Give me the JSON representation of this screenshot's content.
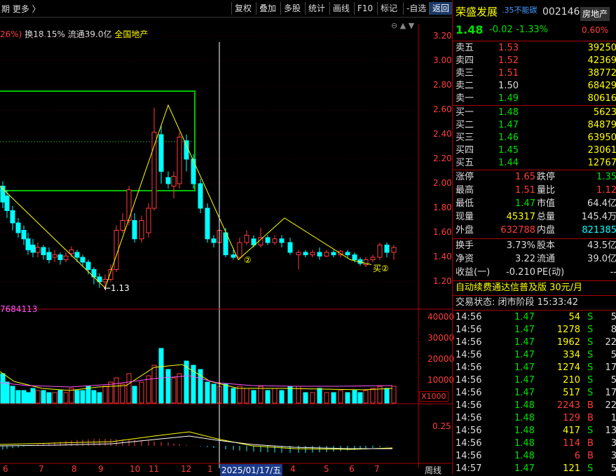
{
  "toolbar": {
    "left_label": "期 更多 〉",
    "buttons": [
      "复权",
      "叠加",
      "多股",
      "统计",
      "画线",
      "F10",
      "标记",
      "-自选",
      "返回"
    ]
  },
  "info": {
    "pct": "26%)",
    "turnover": "换18.15%",
    "float": "流通39.0亿",
    "sector": "全国地产"
  },
  "price_axis": [
    "3.20",
    "3.00",
    "2.80",
    "2.60",
    "2.40",
    "2.20",
    "2.00",
    "1.80",
    "1.60",
    "1.40",
    "1.20"
  ],
  "annotations": {
    "low": "←1.13",
    "mark1": "②",
    "mark2": "买②"
  },
  "volume": {
    "label": "7684113",
    "axis": [
      "40000",
      "30000",
      "20000",
      "10000"
    ],
    "unit": "X1000"
  },
  "macd": {
    "axis_label": "0.25"
  },
  "date_axis": {
    "labels": [
      "6",
      "7",
      "8",
      "9",
      "10",
      "11",
      "12",
      "1",
      "2025/01/17/五",
      "4",
      "5",
      "6",
      "7"
    ],
    "period": "周线"
  },
  "quote": {
    "name": "荣盛发展",
    "note": ".35不能碳",
    "code": "002146",
    "sector_badge": "房地产",
    "price": "1.48",
    "change": "-0.02",
    "change_pct": "-1.33%",
    "sector_pct": "0.60%",
    "asks": [
      {
        "label": "卖五",
        "price": "1.53",
        "vol": "39250"
      },
      {
        "label": "卖四",
        "price": "1.52",
        "vol": "42369"
      },
      {
        "label": "卖三",
        "price": "1.51",
        "vol": "38772"
      },
      {
        "label": "卖二",
        "price": "1.50",
        "vol": "68429"
      },
      {
        "label": "卖一",
        "price": "1.49",
        "vol": "80616"
      }
    ],
    "bids": [
      {
        "label": "买一",
        "price": "1.48",
        "vol": "5623"
      },
      {
        "label": "买二",
        "price": "1.47",
        "vol": "84879"
      },
      {
        "label": "买三",
        "price": "1.46",
        "vol": "63950"
      },
      {
        "label": "买四",
        "price": "1.45",
        "vol": "23061"
      },
      {
        "label": "买五",
        "price": "1.44",
        "vol": "12767"
      }
    ],
    "stats": [
      {
        "l1": "涨停",
        "v1": "1.65",
        "l2": "跌停",
        "v2": "1.35"
      },
      {
        "l1": "最高",
        "v1": "1.51",
        "l2": "量比",
        "v2": "1.12"
      },
      {
        "l1": "最低",
        "v1": "1.47",
        "l2": "市值",
        "v2": "64.4亿"
      },
      {
        "l1": "现量",
        "v1": "45317",
        "l2": "总量",
        "v2": "145.4万"
      },
      {
        "l1": "外盘",
        "v1": "632788",
        "l2": "内盘",
        "v2": "821385"
      }
    ],
    "stats2": [
      {
        "l1": "换手",
        "v1": "3.73%",
        "l2": "股本",
        "v2": "43.5亿"
      },
      {
        "l1": "净资",
        "v1": "3.22",
        "l2": "流通",
        "v2": "39.0亿"
      },
      {
        "l1": "收益(一)",
        "v1": "-0.210",
        "l2": "PE(动)",
        "v2": "--"
      }
    ],
    "ad": "自动续费通达信普及版 30元/月",
    "status": "交易状态: 闭市阶段 15:33:42",
    "trades": [
      {
        "t": "14:56",
        "p": "1.47",
        "v": "54",
        "s": "S",
        "n": "5"
      },
      {
        "t": "14:56",
        "p": "1.47",
        "v": "1278",
        "s": "S",
        "n": "8"
      },
      {
        "t": "14:56",
        "p": "1.47",
        "v": "1962",
        "s": "S",
        "n": "22"
      },
      {
        "t": "14:56",
        "p": "1.47",
        "v": "334",
        "s": "S",
        "n": "5"
      },
      {
        "t": "14:56",
        "p": "1.47",
        "v": "1274",
        "s": "S",
        "n": "17"
      },
      {
        "t": "14:56",
        "p": "1.47",
        "v": "210",
        "s": "S",
        "n": "5"
      },
      {
        "t": "14:56",
        "p": "1.47",
        "v": "517",
        "s": "S",
        "n": "17"
      },
      {
        "t": "14:56",
        "p": "1.48",
        "v": "2243",
        "s": "B",
        "n": "22"
      },
      {
        "t": "14:56",
        "p": "1.48",
        "v": "129",
        "s": "B",
        "n": "1"
      },
      {
        "t": "14:56",
        "p": "1.48",
        "v": "417",
        "s": "S",
        "n": "13"
      },
      {
        "t": "14:56",
        "p": "1.48",
        "v": "114",
        "s": "B",
        "n": "3"
      },
      {
        "t": "14:56",
        "p": "1.48",
        "v": "6",
        "s": "B",
        "n": "3"
      },
      {
        "t": "14:57",
        "p": "1.47",
        "v": "121",
        "s": "S",
        "n": "5"
      }
    ]
  },
  "colors": {
    "up": "#ff3c3c",
    "down": "#00ffff",
    "bull_candle": "#ff3c3c",
    "bear_candle": "#00ffff",
    "box": "#00c000"
  }
}
